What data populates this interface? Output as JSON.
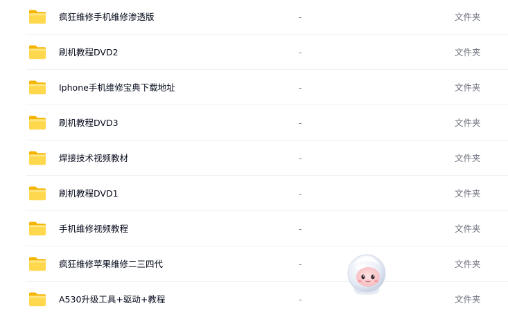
{
  "files": [
    {
      "name": "疯狂维修手机维修渗透版",
      "size": "-",
      "type": "文件夹",
      "icon": "folder-icon"
    },
    {
      "name": "刷机教程DVD2",
      "size": "-",
      "type": "文件夹",
      "icon": "folder-icon"
    },
    {
      "name": "Iphone手机维修宝典下载地址",
      "size": "-",
      "type": "文件夹",
      "icon": "folder-icon"
    },
    {
      "name": "刷机教程DVD3",
      "size": "-",
      "type": "文件夹",
      "icon": "folder-icon"
    },
    {
      "name": "焊接技术视频教材",
      "size": "-",
      "type": "文件夹",
      "icon": "folder-icon"
    },
    {
      "name": "刷机教程DVD1",
      "size": "-",
      "type": "文件夹",
      "icon": "folder-icon"
    },
    {
      "name": "手机维修视频教程",
      "size": "-",
      "type": "文件夹",
      "icon": "folder-icon"
    },
    {
      "name": "疯狂维修苹果维修二三四代",
      "size": "-",
      "type": "文件夹",
      "icon": "folder-icon"
    },
    {
      "name": "A530升级工具+驱动+教程",
      "size": "-",
      "type": "文件夹",
      "icon": "folder-icon"
    }
  ],
  "colors": {
    "folder_back": "#f4b400",
    "folder_front": "#ffd84d",
    "text_primary": "#03081a",
    "text_secondary": "#6b6f7b",
    "divider": "#f0f1f5"
  },
  "mascot": {
    "icon": "assistant-mascot-icon"
  }
}
